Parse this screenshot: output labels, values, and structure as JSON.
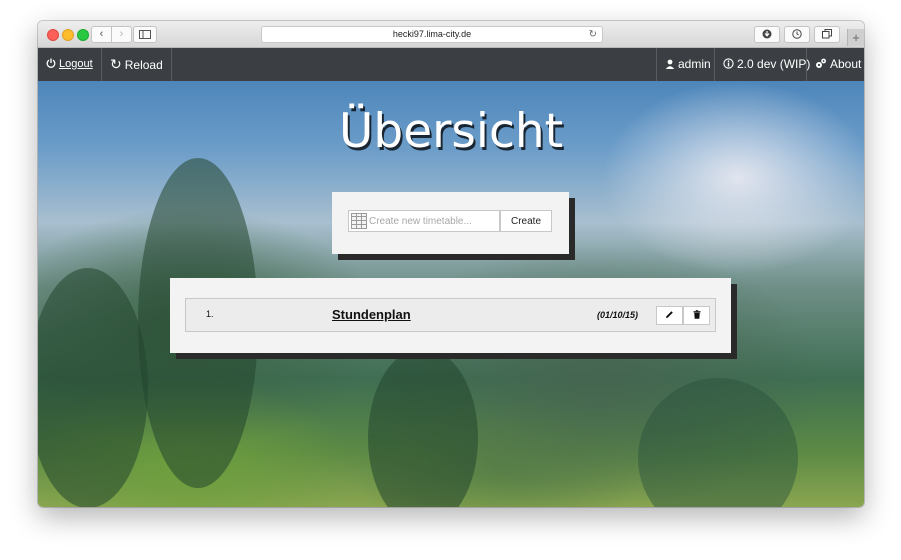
{
  "browser": {
    "url": "hecki97.lima-city.de",
    "back_glyph": "‹",
    "forward_glyph": "›",
    "new_tab_glyph": "+",
    "icons": [
      "sidebar-icon",
      "reload-icon",
      "download-icon",
      "history-icon",
      "tabs-icon"
    ]
  },
  "navbar": {
    "logout_label": "Logout",
    "reload_label": "Reload",
    "user_label": "admin",
    "version_label": "2.0 dev (WIP)",
    "about_label": "About"
  },
  "page": {
    "title": "Übersicht"
  },
  "create": {
    "placeholder": "Create new timetable...",
    "value": "",
    "button_label": "Create"
  },
  "timetables": [
    {
      "index": "1.",
      "name": "Stundenplan",
      "date": "(01/10/15)"
    }
  ],
  "colors": {
    "navbar_bg": "#3b3f43",
    "card_bg": "#f3f3f3",
    "card_shadow": "#2a2a2a"
  }
}
